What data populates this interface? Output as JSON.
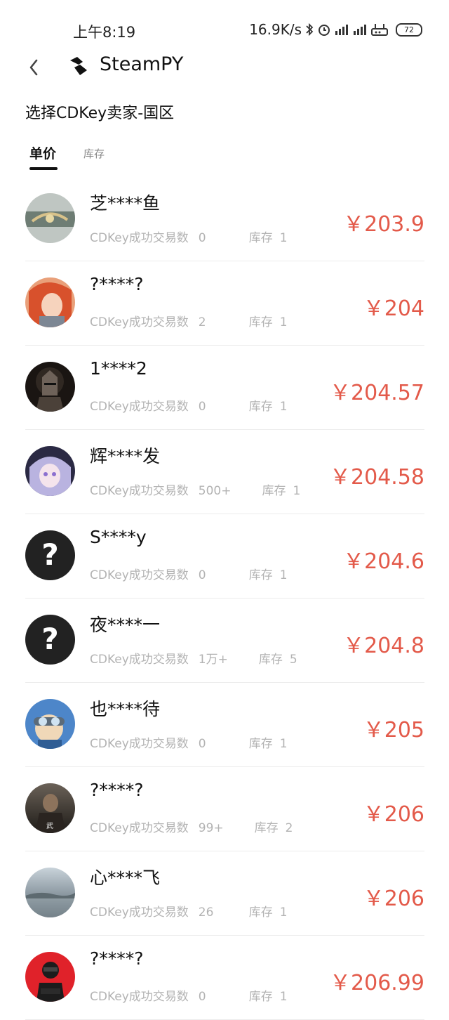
{
  "status": {
    "time": "上午8:19",
    "speed": "16.9K/s",
    "battery": "72"
  },
  "header": {
    "app_name": "SteamPY"
  },
  "page": {
    "title": "选择CDKey卖家-国区"
  },
  "tabs": [
    {
      "label": "单价",
      "active": true
    },
    {
      "label": "库存",
      "active": false
    }
  ],
  "labels": {
    "trades": "CDKey成功交易数",
    "stock": "库存"
  },
  "accent_color": "#e35a4a",
  "sellers": [
    {
      "name": "芝****鱼",
      "trades": "0",
      "stock": "1",
      "price": "￥203.9",
      "avatar": "game-art-avatar"
    },
    {
      "name": "?****?",
      "trades": "2",
      "stock": "1",
      "price": "￥204",
      "avatar": "red-hair-anime-avatar"
    },
    {
      "name": "1****2",
      "trades": "0",
      "stock": "1",
      "price": "￥204.57",
      "avatar": "dark-knight-avatar"
    },
    {
      "name": "辉****发",
      "trades": "500+",
      "stock": "1",
      "price": "￥204.58",
      "avatar": "anime-girl-avatar"
    },
    {
      "name": "S****y",
      "trades": "0",
      "stock": "1",
      "price": "￥204.6",
      "avatar": "question-mark-avatar"
    },
    {
      "name": "夜****一",
      "trades": "1万+",
      "stock": "5",
      "price": "￥204.8",
      "avatar": "question-mark-avatar"
    },
    {
      "name": "也****待",
      "trades": "0",
      "stock": "1",
      "price": "￥205",
      "avatar": "goggles-character-avatar"
    },
    {
      "name": "?****?",
      "trades": "99+",
      "stock": "2",
      "price": "￥206",
      "avatar": "warrior-avatar"
    },
    {
      "name": "心****飞",
      "trades": "26",
      "stock": "1",
      "price": "￥206",
      "avatar": "landscape-avatar"
    },
    {
      "name": "?****?",
      "trades": "0",
      "stock": "1",
      "price": "￥206.99",
      "avatar": "counter-strike-avatar"
    }
  ]
}
